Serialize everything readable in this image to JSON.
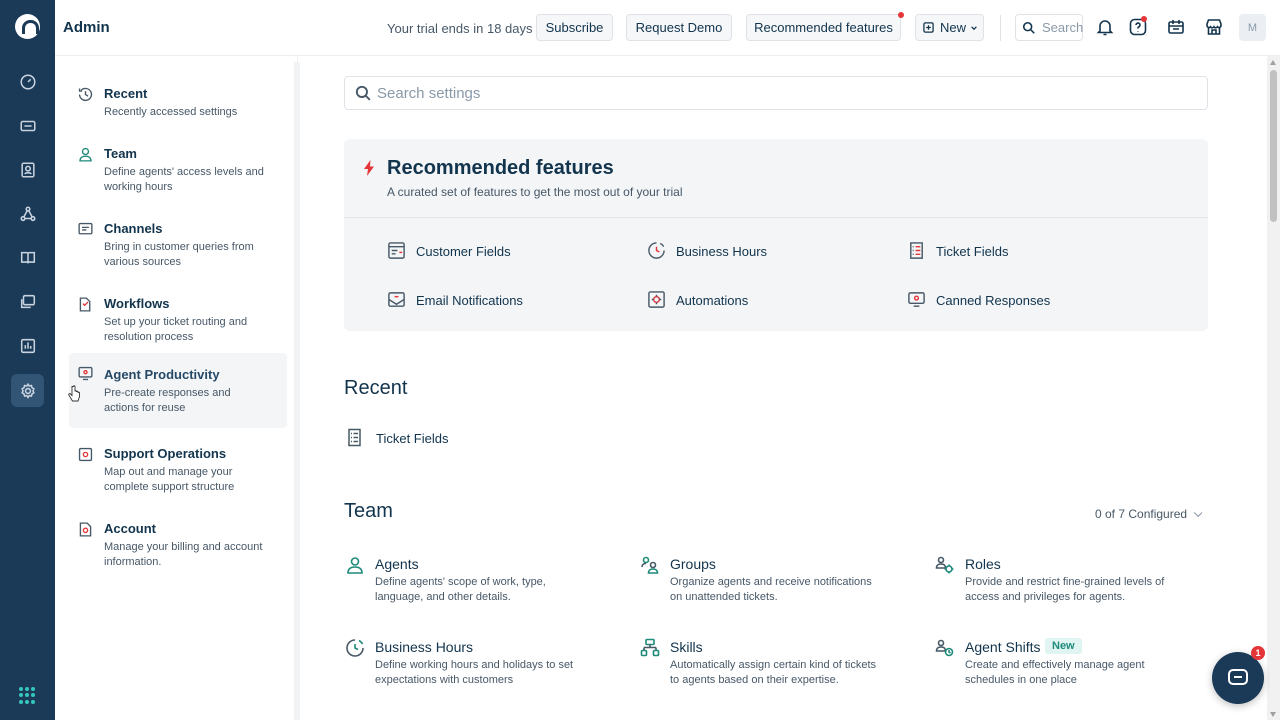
{
  "header": {
    "title": "Admin",
    "trial_text": "Your trial ends in 18 days",
    "subscribe_label": "Subscribe",
    "request_demo_label": "Request Demo",
    "recommended_label": "Recommended features",
    "new_label": "New",
    "search_placeholder": "Search",
    "avatar_initial": "M"
  },
  "rail": {
    "icons": [
      "dashboard-icon",
      "tickets-icon",
      "contacts-icon",
      "groups-icon",
      "knowledge-base-icon",
      "forums-icon",
      "reports-icon",
      "admin-settings-icon"
    ],
    "active": "admin-settings-icon"
  },
  "settings_nav": {
    "items": [
      {
        "title": "Recent",
        "desc": "Recently accessed settings",
        "icon": "clock-icon"
      },
      {
        "title": "Team",
        "desc": "Define agents' access levels and working hours",
        "icon": "user-icon"
      },
      {
        "title": "Channels",
        "desc": "Bring in customer queries from various sources",
        "icon": "chat-icon"
      },
      {
        "title": "Workflows",
        "desc": "Set up your ticket routing and resolution process",
        "icon": "workflow-icon"
      },
      {
        "title": "Agent Productivity",
        "desc": "Pre-create responses and actions for reuse",
        "icon": "productivity-icon"
      },
      {
        "title": "Support Operations",
        "desc": "Map out and manage your complete support structure",
        "icon": "operations-icon"
      },
      {
        "title": "Account",
        "desc": "Manage your billing and account information.",
        "icon": "account-icon"
      }
    ],
    "active_index": 4
  },
  "main": {
    "search_placeholder": "Search settings",
    "recommended": {
      "title": "Recommended features",
      "subtitle": "A curated set of features to get the most out of your trial",
      "links": [
        "Customer Fields",
        "Business Hours",
        "Ticket Fields",
        "Email Notifications",
        "Automations",
        "Canned Responses"
      ]
    },
    "recent": {
      "title": "Recent",
      "items": [
        "Ticket Fields"
      ]
    },
    "team": {
      "title": "Team",
      "configured": "0 of 7 Configured",
      "items": [
        {
          "title": "Agents",
          "desc": "Define agents' scope of work, type, language, and other details."
        },
        {
          "title": "Groups",
          "desc": "Organize agents and receive notifications on unattended tickets."
        },
        {
          "title": "Roles",
          "desc": "Provide and restrict fine-grained levels of access and privileges for agents."
        },
        {
          "title": "Business Hours",
          "desc": "Define working hours and holidays to set expectations with customers"
        },
        {
          "title": "Skills",
          "desc": "Automatically assign certain kind of tickets to agents based on their expertise."
        },
        {
          "title": "Agent Shifts",
          "desc": "Create and effectively manage agent schedules in one place",
          "badge": "New"
        }
      ]
    }
  },
  "chat_widget": {
    "badge_count": "1"
  },
  "colors": {
    "rail": "#1b3a57",
    "accent_red": "#e43538",
    "accent_teal": "#1e8a7a",
    "text": "#12344d"
  }
}
